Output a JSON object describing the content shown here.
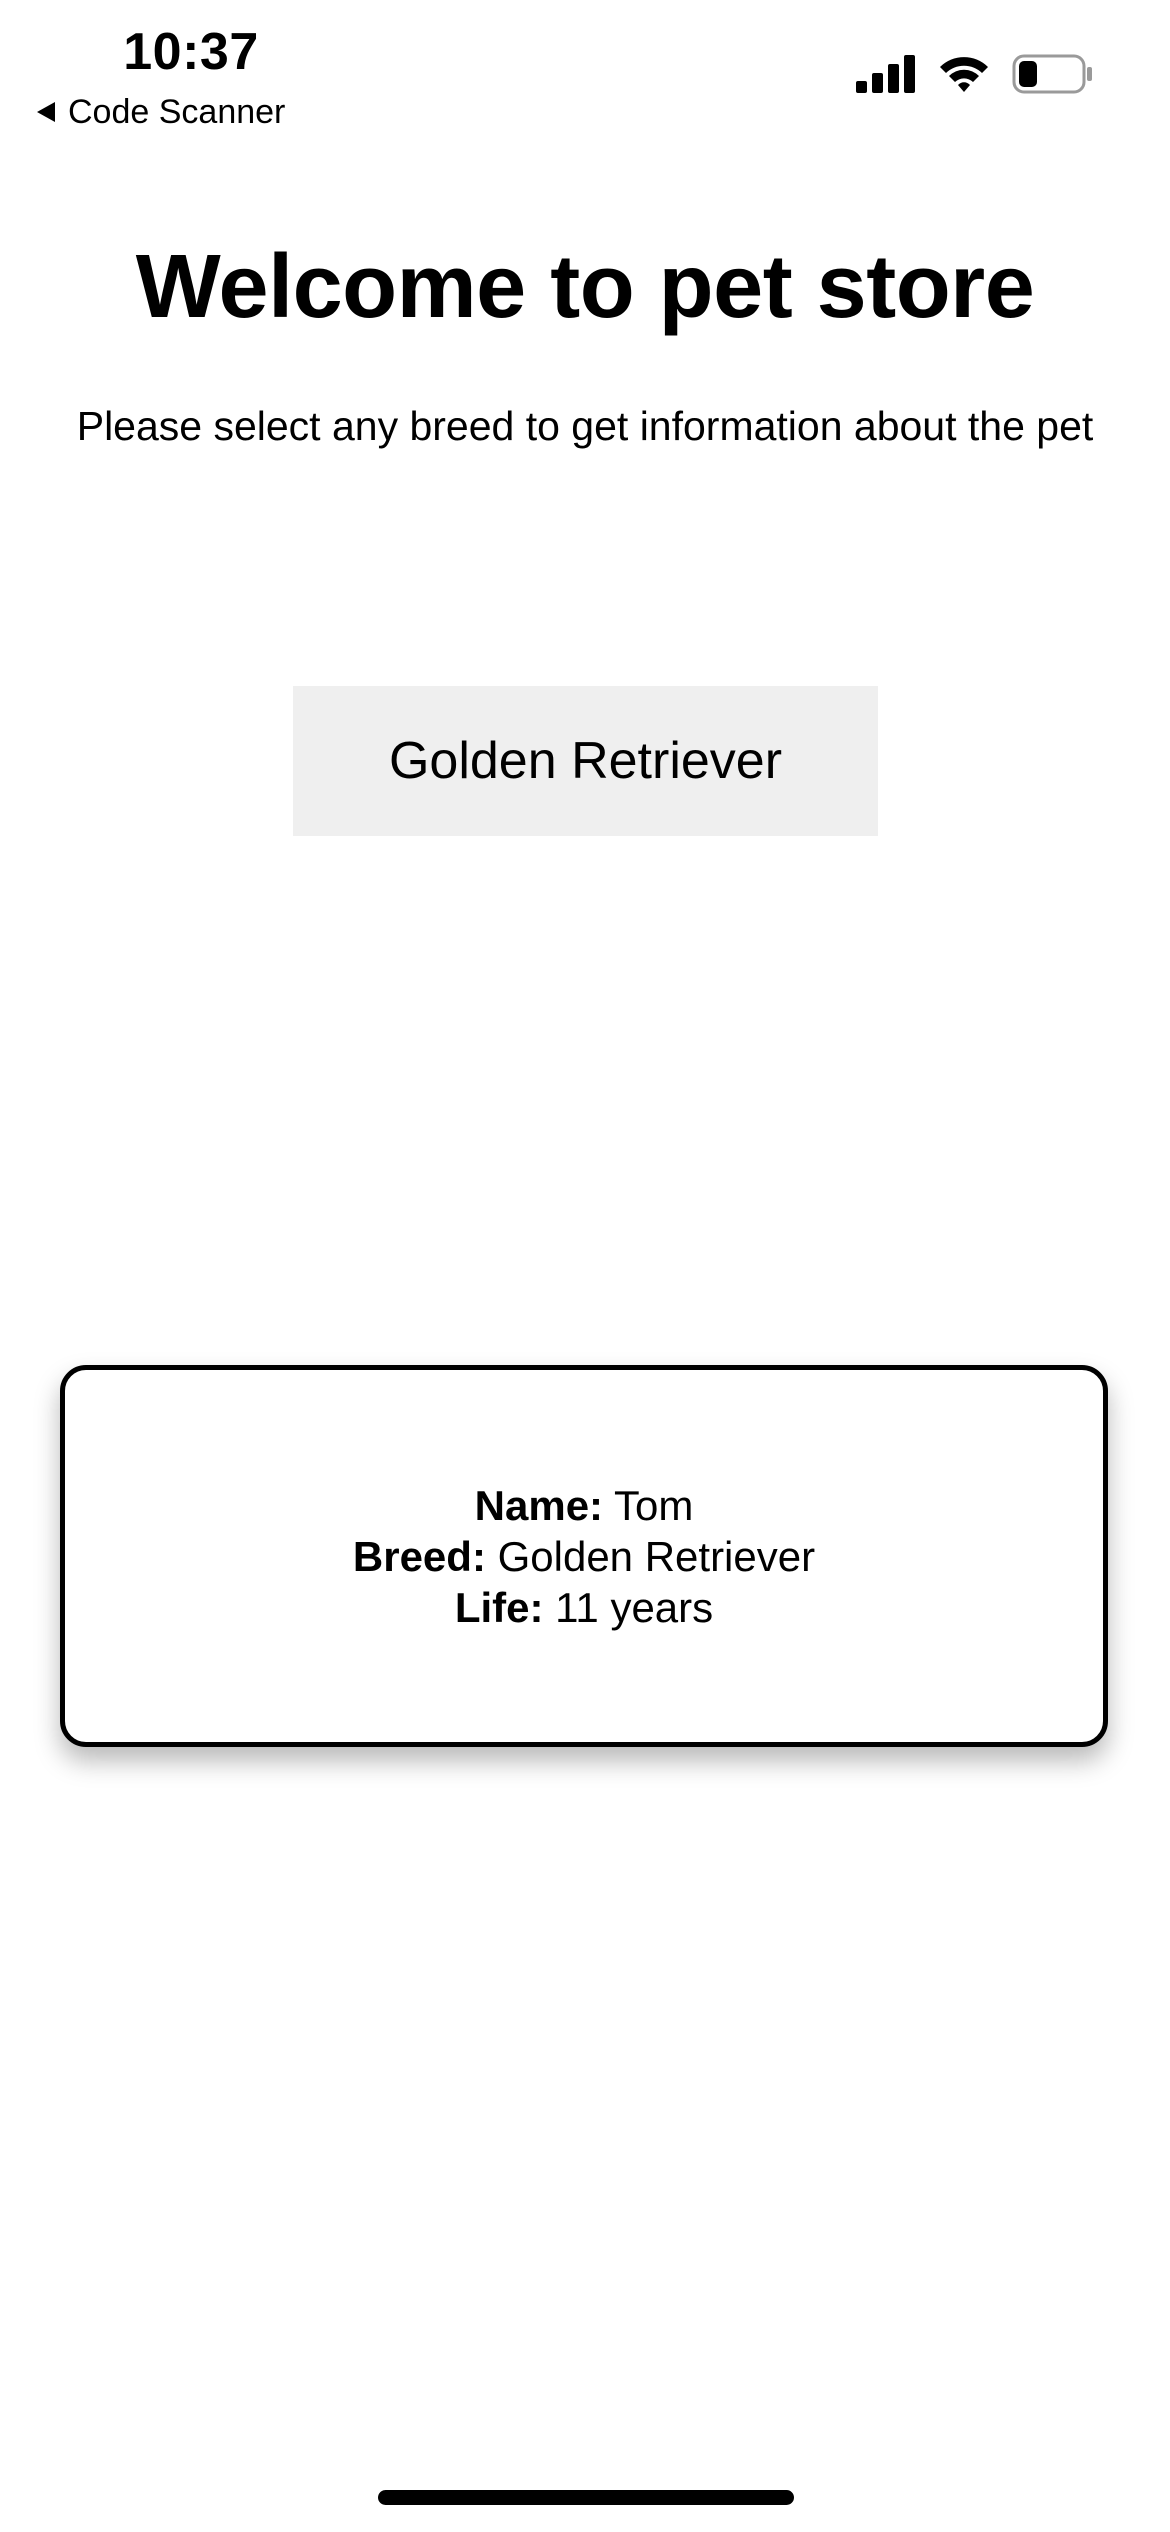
{
  "status_bar": {
    "time": "10:37",
    "back_label": "Code Scanner",
    "icons": [
      "back-triangle-icon",
      "cellular-signal-icon",
      "wifi-icon",
      "battery-icon"
    ],
    "battery_level": 0.3
  },
  "header": {
    "title": "Welcome to pet store",
    "subtitle": "Please select any breed to get information about the pet"
  },
  "breed_selector": {
    "selected": "Golden Retriever"
  },
  "pet_card": {
    "name_label": "Name:",
    "name_value": "Tom",
    "breed_label": "Breed:",
    "breed_value": "Golden Retriever",
    "life_label": "Life:",
    "life_value": "11 years"
  },
  "colors": {
    "background": "#ffffff",
    "text": "#000000",
    "button_background": "#efefef",
    "card_border": "#000000"
  }
}
